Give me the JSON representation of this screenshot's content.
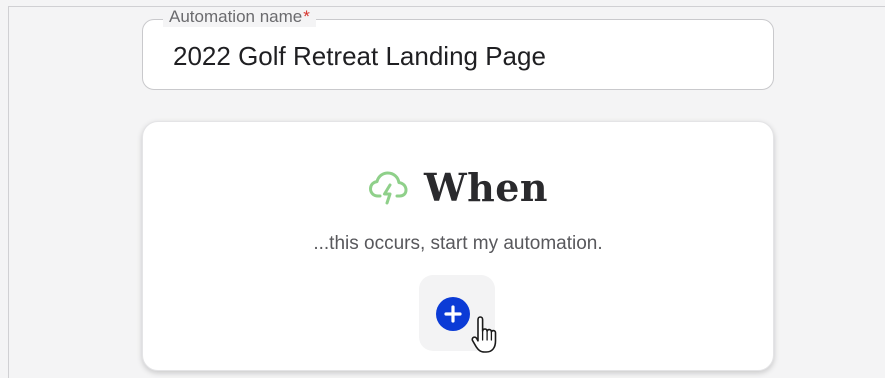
{
  "automation_name": {
    "label": "Automation name",
    "required_marker": "*",
    "value": "2022 Golf Retreat Landing Page"
  },
  "trigger_card": {
    "icon": "cloud-lightning-icon",
    "title": "When",
    "subtitle": "...this occurs, start my automation.",
    "add_button_icon": "plus-circle-icon"
  },
  "colors": {
    "accent_blue": "#0b3bd6",
    "trigger_icon_green": "#8fd08a",
    "required_red": "#d6332c"
  },
  "cursor": "hand-pointer-icon"
}
